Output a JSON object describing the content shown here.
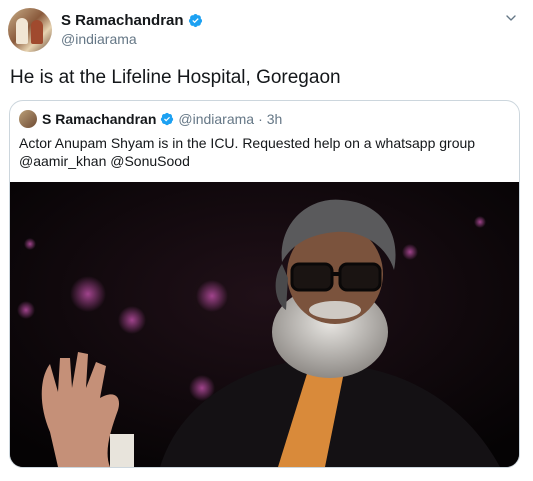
{
  "author": {
    "name": "S Ramachandran",
    "handle": "@indiarama",
    "verified": true
  },
  "tweet": {
    "text": "He is at the Lifeline Hospital, Goregaon"
  },
  "quoted_tweet": {
    "name": "S Ramachandran",
    "handle": "@indiarama",
    "separator": "·",
    "time": "3h",
    "line1": "Actor Anupam Shyam is in the ICU. Requested help on a whatsapp group",
    "line2": "@aamir_khan @SonuSood"
  },
  "colors": {
    "verified_blue": "#1da1f2",
    "text_primary": "#14171a",
    "text_secondary": "#657786",
    "border": "#ccd6dd"
  },
  "icons": {
    "menu": "chevron-down-icon",
    "verified": "verified-badge-icon"
  }
}
